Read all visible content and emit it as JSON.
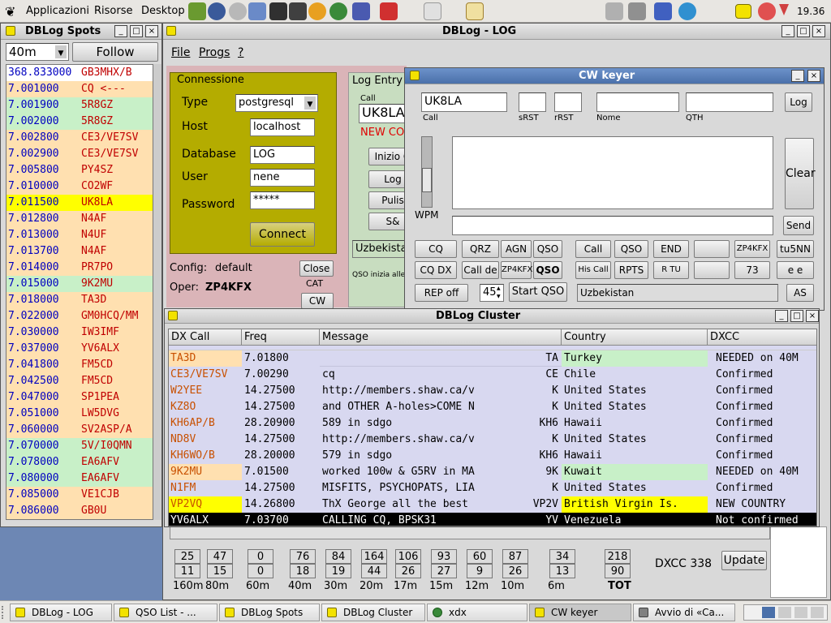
{
  "top_panel": {
    "menus": [
      "Applicazioni",
      "Risorse",
      "Desktop"
    ],
    "clock": "19.36"
  },
  "spots": {
    "title": "DBLog Spots",
    "band": "40m",
    "follow_label": "Follow",
    "rows": [
      {
        "freq": "368.833000",
        "call": "GB3MHX/B",
        "bg": "#ffffff"
      },
      {
        "freq": "7.001000",
        "call": "CQ <---",
        "bg": "#ffe0b0"
      },
      {
        "freq": "7.001900",
        "call": "5R8GZ",
        "bg": "#c8f0c8"
      },
      {
        "freq": "7.002000",
        "call": "5R8GZ",
        "bg": "#c8f0c8"
      },
      {
        "freq": "7.002800",
        "call": "CE3/VE7SV",
        "bg": "#ffe0b0"
      },
      {
        "freq": "7.002900",
        "call": "CE3/VE7SV",
        "bg": "#ffe0b0"
      },
      {
        "freq": "7.005800",
        "call": "PY4SZ",
        "bg": "#ffe0b0"
      },
      {
        "freq": "7.010000",
        "call": "CO2WF",
        "bg": "#ffe0b0"
      },
      {
        "freq": "7.011500",
        "call": "UK8LA",
        "bg": "#ffff00"
      },
      {
        "freq": "7.012800",
        "call": "N4AF",
        "bg": "#ffe0b0"
      },
      {
        "freq": "7.013000",
        "call": "N4UF",
        "bg": "#ffe0b0"
      },
      {
        "freq": "7.013700",
        "call": "N4AF",
        "bg": "#ffe0b0"
      },
      {
        "freq": "7.014000",
        "call": "PR7PO",
        "bg": "#ffe0b0"
      },
      {
        "freq": "7.015000",
        "call": "9K2MU",
        "bg": "#c8f0c8"
      },
      {
        "freq": "7.018000",
        "call": "TA3D",
        "bg": "#ffe0b0"
      },
      {
        "freq": "7.022000",
        "call": "GM0HCQ/MM",
        "bg": "#ffe0b0"
      },
      {
        "freq": "7.030000",
        "call": "IW3IMF",
        "bg": "#ffe0b0"
      },
      {
        "freq": "7.037000",
        "call": "YV6ALX",
        "bg": "#ffe0b0"
      },
      {
        "freq": "7.041800",
        "call": "FM5CD",
        "bg": "#ffe0b0"
      },
      {
        "freq": "7.042500",
        "call": "FM5CD",
        "bg": "#ffe0b0"
      },
      {
        "freq": "7.047000",
        "call": "SP1PEA",
        "bg": "#ffe0b0"
      },
      {
        "freq": "7.051000",
        "call": "LW5DVG",
        "bg": "#ffe0b0"
      },
      {
        "freq": "7.060000",
        "call": "SV2ASP/A",
        "bg": "#ffe0b0"
      },
      {
        "freq": "7.070000",
        "call": "5V/I0QMN",
        "bg": "#c8f0c8"
      },
      {
        "freq": "7.078000",
        "call": "EA6AFV",
        "bg": "#c8f0c8"
      },
      {
        "freq": "7.080000",
        "call": "EA6AFV",
        "bg": "#c8f0c8"
      },
      {
        "freq": "7.085000",
        "call": "VE1CJB",
        "bg": "#ffe0b0"
      },
      {
        "freq": "7.086000",
        "call": "GB0U",
        "bg": "#ffe0b0"
      }
    ]
  },
  "log": {
    "title": "DBLog - LOG",
    "menu": [
      "File",
      "Progs",
      "?"
    ],
    "connessione": {
      "legend": "Connessione",
      "type_label": "Type",
      "type_value": "postgresql",
      "host_label": "Host",
      "host_value": "localhost",
      "db_label": "Database",
      "db_value": "LOG",
      "user_label": "User",
      "user_value": "nene",
      "pass_label": "Password",
      "pass_value": "*****",
      "connect_label": "Connect"
    },
    "config_label": "Config:",
    "config_value": "default",
    "oper_label": "Oper:",
    "oper_value": "ZP4KFX",
    "close_label": "Close",
    "cat_label": "CAT",
    "cw_label": "CW",
    "log_entry": {
      "legend": "Log Entry",
      "call_label": "Call",
      "call_value": "UK8LA",
      "new_country": "NEW CO",
      "btn_inizio": "Inizio Q",
      "btn_log": "Log",
      "btn_pulisci": "Pulis",
      "btn_s": "S&",
      "country": "Uzbekistan",
      "qso_inizia": "QSO inizia alle"
    },
    "stats": {
      "row1": [
        "25",
        "47",
        "0",
        "76",
        "84",
        "164",
        "106",
        "93",
        "60",
        "87",
        "34"
      ],
      "row2": [
        "11",
        "15",
        "0",
        "18",
        "19",
        "44",
        "26",
        "27",
        "9",
        "26",
        "13"
      ],
      "bands": [
        "160m",
        "80m",
        "60m",
        "40m",
        "30m",
        "20m",
        "17m",
        "15m",
        "12m",
        "10m",
        "6m"
      ],
      "tot1": "218",
      "tot2": "90",
      "tot_label": "TOT",
      "dxcc": "DXCC 338",
      "update_label": "Update"
    }
  },
  "cw": {
    "title": "CW keyer",
    "call_value": "UK8LA",
    "call_label": "Call",
    "srst_label": "sRST",
    "rrst_label": "rRST",
    "nome_label": "Nome",
    "qth_label": "QTH",
    "log_label": "Log",
    "clear_label": "Clear",
    "send_label": "Send",
    "wpm_label": "WPM",
    "buttons_row1": [
      "CQ",
      "QRZ",
      "AGN",
      "QSO",
      "Call",
      "QSO",
      "END",
      "",
      "ZP4KFX",
      "tu5NN"
    ],
    "buttons_row2": [
      "CQ DX",
      "Call de",
      "ZP4KFX",
      "QSO",
      "His Call",
      "RPTS",
      "R TU",
      "",
      "73",
      "e e"
    ],
    "rep_label": "REP off",
    "wpm_value": "45",
    "start_qso_label": "Start QSO",
    "country": "Uzbekistan",
    "as_label": "AS"
  },
  "cluster": {
    "title": "DBLog Cluster",
    "headers": [
      "DX Call",
      "Freq",
      "Message",
      "Country",
      "DXCC"
    ],
    "rows": [
      {
        "call": "TA3D",
        "freq": "7.01800",
        "msg": "",
        "pfx": "TA",
        "country": "Turkey",
        "dxcc": "NEEDED on 40M",
        "bg": "#ffe0b0",
        "cbg": "#c8f0c8"
      },
      {
        "call": "CE3/VE7SV",
        "freq": "7.00290",
        "msg": "cq",
        "pfx": "CE",
        "country": "Chile",
        "dxcc": "Confirmed",
        "bg": "#d8d8f0",
        "cbg": "#d8d8f0"
      },
      {
        "call": "W2YEE",
        "freq": "14.27500",
        "msg": "http://members.shaw.ca/v",
        "pfx": "K",
        "country": "United States",
        "dxcc": "Confirmed",
        "bg": "#d8d8f0",
        "cbg": "#d8d8f0"
      },
      {
        "call": "KZ8O",
        "freq": "14.27500",
        "msg": "and OTHER A-holes>COME N",
        "pfx": "K",
        "country": "United States",
        "dxcc": "Confirmed",
        "bg": "#d8d8f0",
        "cbg": "#d8d8f0"
      },
      {
        "call": "KH6AP/B",
        "freq": "28.20900",
        "msg": "589 in sdgo",
        "pfx": "KH6",
        "country": "Hawaii",
        "dxcc": "Confirmed",
        "bg": "#d8d8f0",
        "cbg": "#d8d8f0"
      },
      {
        "call": "ND8V",
        "freq": "14.27500",
        "msg": "http://members.shaw.ca/v",
        "pfx": "K",
        "country": "United States",
        "dxcc": "Confirmed",
        "bg": "#d8d8f0",
        "cbg": "#d8d8f0"
      },
      {
        "call": "KH6WO/B",
        "freq": "28.20000",
        "msg": "579 in sdgo",
        "pfx": "KH6",
        "country": "Hawaii",
        "dxcc": "Confirmed",
        "bg": "#d8d8f0",
        "cbg": "#d8d8f0"
      },
      {
        "call": "9K2MU",
        "freq": "7.01500",
        "msg": "worked 100w & G5RV in MA",
        "pfx": "9K",
        "country": "Kuwait",
        "dxcc": "NEEDED on 40M",
        "bg": "#ffe0b0",
        "cbg": "#c8f0c8"
      },
      {
        "call": "N1FM",
        "freq": "14.27500",
        "msg": "MISFITS, PSYCHOPATS, LIA",
        "pfx": "K",
        "country": "United States",
        "dxcc": "Confirmed",
        "bg": "#d8d8f0",
        "cbg": "#d8d8f0"
      },
      {
        "call": "VP2VQ",
        "freq": "14.26800",
        "msg": "ThX George all the best",
        "pfx": "VP2V",
        "country": "British Virgin Is.",
        "dxcc": "NEW COUNTRY",
        "bg": "#ffff00",
        "cbg": "#ffff00"
      },
      {
        "call": "YV6ALX",
        "freq": "7.03700",
        "msg": "CALLING CQ, BPSK31",
        "pfx": "YV",
        "country": "Venezuela",
        "dxcc": "Not confirmed",
        "bg": "#000000",
        "cbg": "#000000"
      }
    ]
  },
  "taskbar": {
    "tasks": [
      "DBLog - LOG",
      "QSO List - ...",
      "DBLog Spots",
      "DBLog Cluster",
      "xdx",
      "CW keyer",
      "Avvio di «Ca..."
    ]
  }
}
